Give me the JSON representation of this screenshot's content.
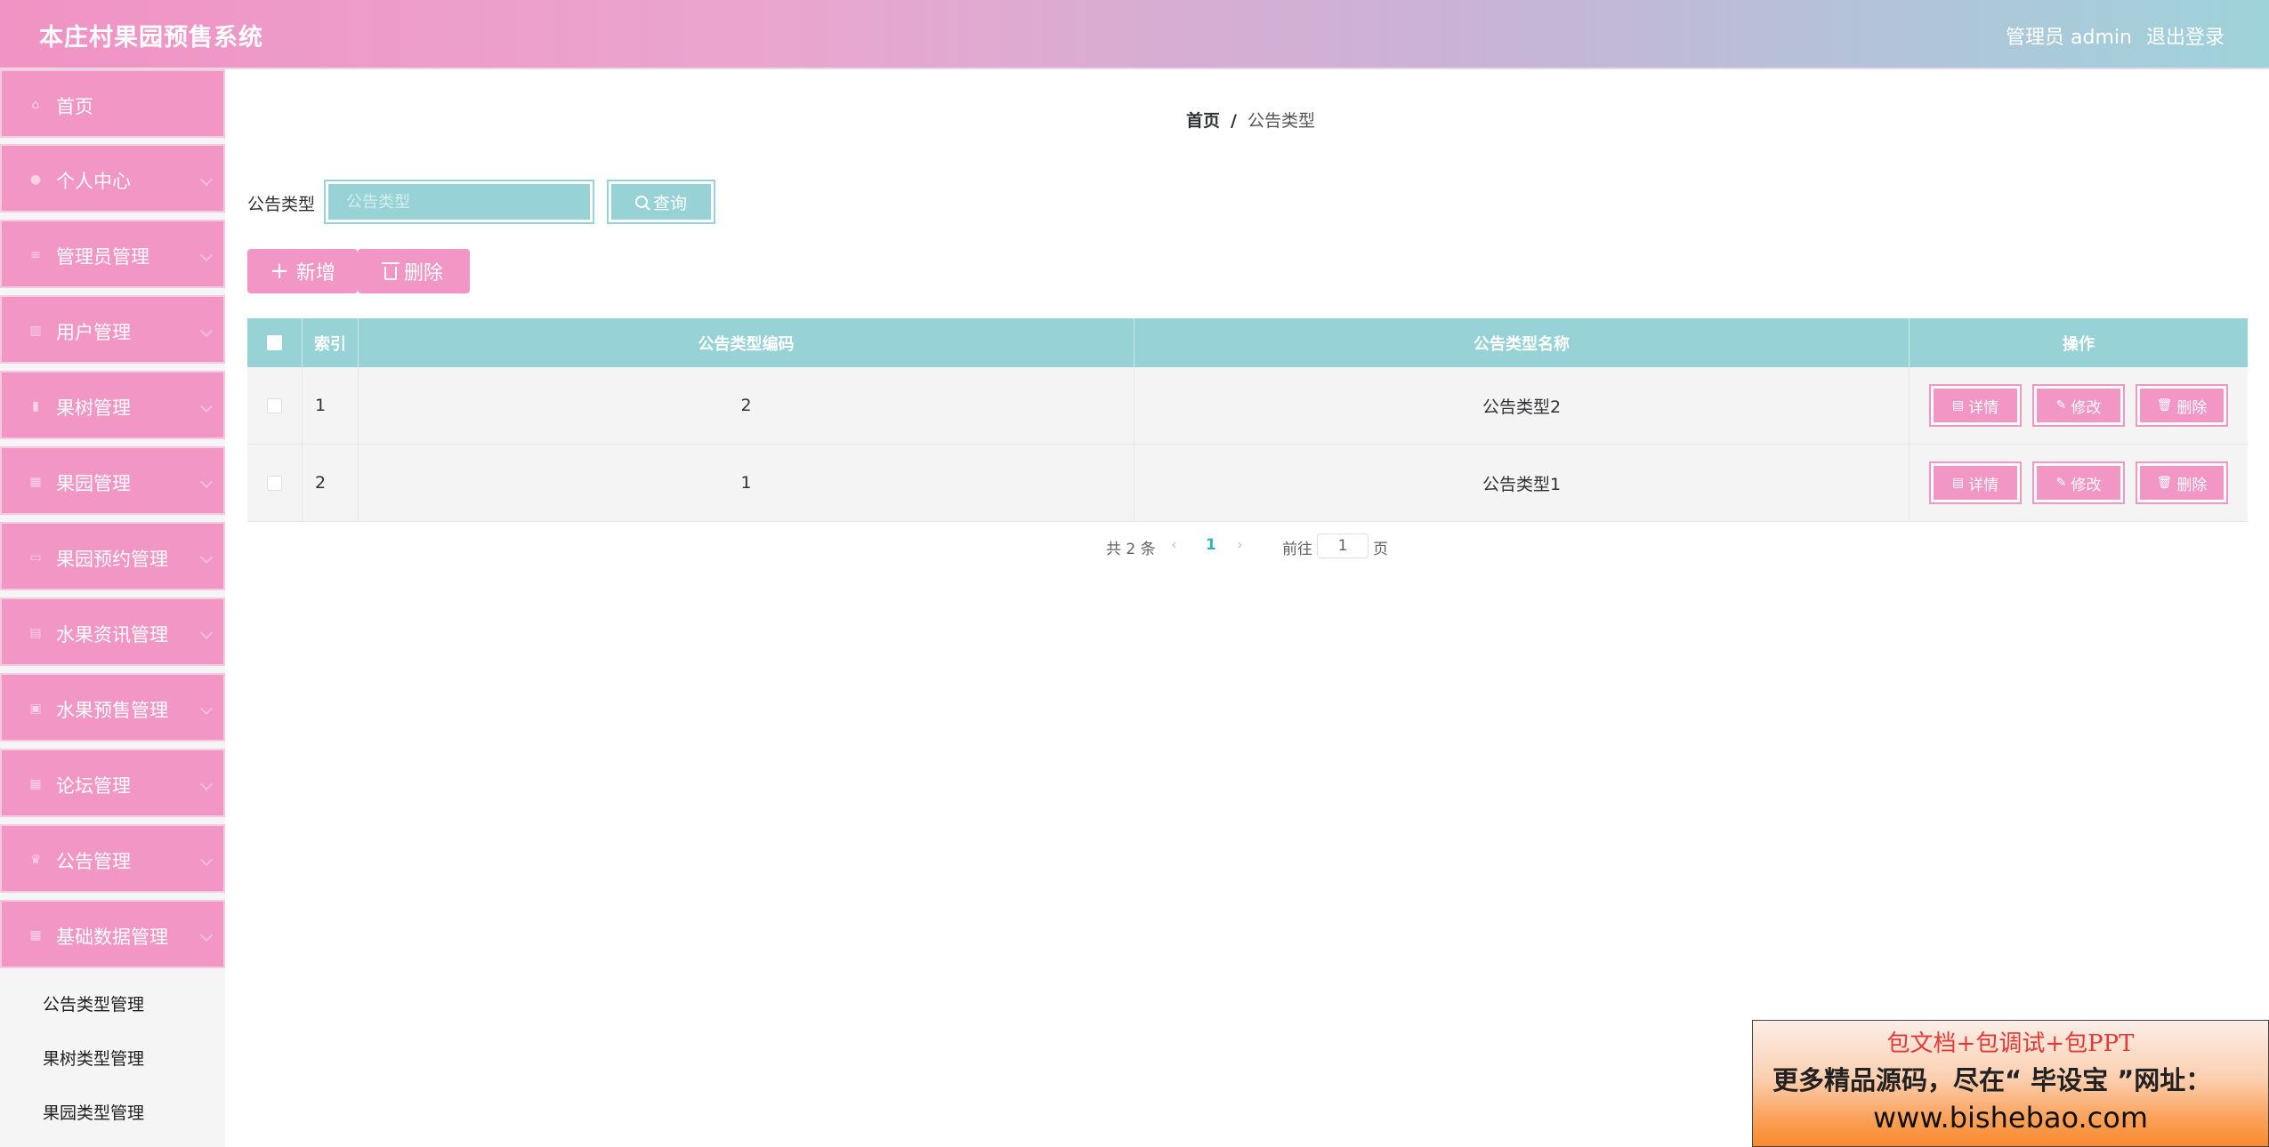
{
  "header": {
    "title": "本庄村果园预售系统",
    "user": "管理员 admin",
    "logout": "退出登录"
  },
  "sidebar": {
    "items": [
      {
        "label": "首页",
        "icon": "home-icon"
      },
      {
        "label": "个人中心",
        "icon": "user-icon"
      },
      {
        "label": "管理员管理",
        "icon": "list-icon"
      },
      {
        "label": "用户管理",
        "icon": "users-icon"
      },
      {
        "label": "果树管理",
        "icon": "bar-chart-icon"
      },
      {
        "label": "果园管理",
        "icon": "grid-icon"
      },
      {
        "label": "果园预约管理",
        "icon": "monitor-icon"
      },
      {
        "label": "水果资讯管理",
        "icon": "table-icon"
      },
      {
        "label": "水果预售管理",
        "icon": "document-icon"
      },
      {
        "label": "论坛管理",
        "icon": "grid-icon"
      },
      {
        "label": "公告管理",
        "icon": "trophy-icon"
      },
      {
        "label": "基础数据管理",
        "icon": "grid-icon"
      }
    ],
    "subitems": [
      "公告类型管理",
      "果树类型管理",
      "果园类型管理"
    ]
  },
  "breadcrumb": {
    "home": "首页",
    "separator": "/",
    "current": "公告类型"
  },
  "search": {
    "label": "公告类型",
    "placeholder": "公告类型",
    "button": "查询"
  },
  "actions": {
    "add": "新增",
    "delete": "删除"
  },
  "table": {
    "headers": [
      "索引",
      "公告类型编码",
      "公告类型名称",
      "操作"
    ],
    "rows": [
      {
        "index": "1",
        "code": "2",
        "name": "公告类型2"
      },
      {
        "index": "2",
        "code": "1",
        "name": "公告类型1"
      }
    ],
    "row_actions": {
      "detail": "详情",
      "edit": "修改",
      "delete": "删除"
    }
  },
  "pagination": {
    "total": "共 2 条",
    "current_page": "1",
    "goto_label": "前往",
    "goto_value": "1",
    "page_suffix": "页"
  },
  "ad": {
    "line1": "包文档+包调试+包PPT",
    "line2": "更多精品源码，尽在“ 毕设宝 ”网址：",
    "line3": "www.bishebao.com"
  },
  "colors": {
    "primary_pink": "#f196c5",
    "teal": "#97d2d6"
  }
}
